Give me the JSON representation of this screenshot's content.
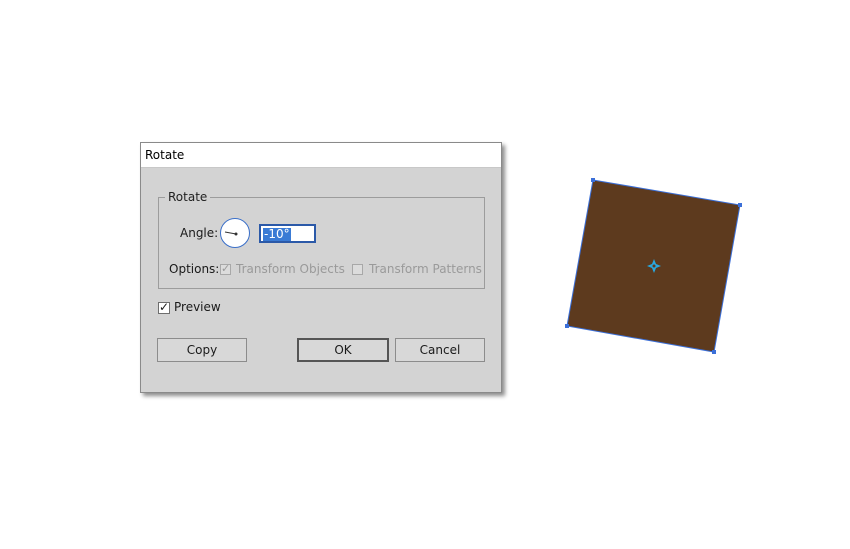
{
  "dialog": {
    "title": "Rotate",
    "group_label": "Rotate",
    "angle_label": "Angle:",
    "angle_value": "-10°",
    "options_label": "Options:",
    "transform_objects_label": "Transform Objects",
    "transform_patterns_label": "Transform Patterns",
    "transform_objects_checked": true,
    "transform_patterns_checked": false,
    "preview_label": "Preview",
    "preview_checked": true,
    "copy_label": "Copy",
    "ok_label": "OK",
    "cancel_label": "Cancel"
  },
  "artwork": {
    "fill_color": "#5d3a1e",
    "selection_color": "#3b6fd8",
    "center_marker_color": "#29a8e0",
    "rotation_degrees": -10
  }
}
